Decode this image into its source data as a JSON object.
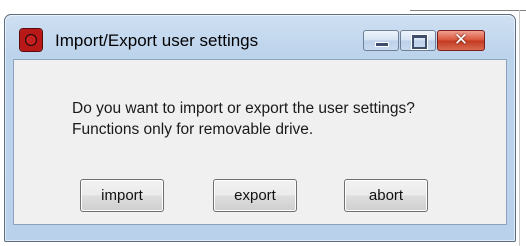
{
  "window": {
    "title": "Import/Export user settings",
    "icon": "app-red-circle-icon",
    "controls": {
      "minimize_icon": "minimize-icon",
      "maximize_icon": "maximize-icon",
      "close_icon": "close-icon",
      "close_glyph": "✕"
    }
  },
  "dialog": {
    "message_line1": "Do you want to import or export the user settings?",
    "message_line2": "Functions only for removable drive.",
    "buttons": {
      "import_label": "import",
      "export_label": "export",
      "abort_label": "abort"
    }
  },
  "colors": {
    "titlebar": "#bcd3ec",
    "close_button": "#c23a22",
    "client_background": "#f0f0f0"
  }
}
